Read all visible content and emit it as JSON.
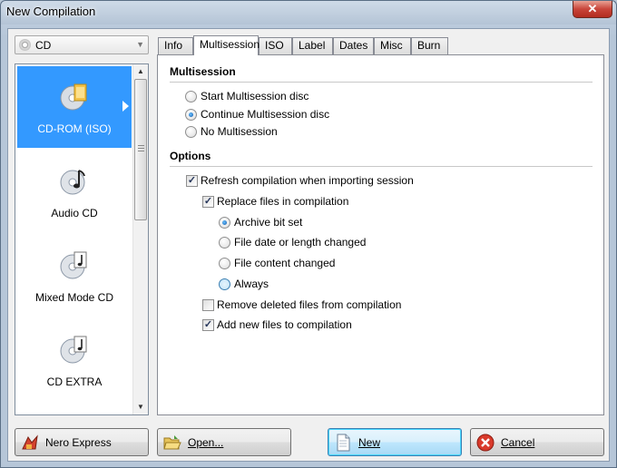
{
  "window": {
    "title": "New Compilation",
    "close_glyph": "✕"
  },
  "device": {
    "selected": "CD",
    "icon": "disc-icon"
  },
  "compilation_types": [
    {
      "label": "CD-ROM (ISO)",
      "icon": "cdrom-iso-icon",
      "selected": true
    },
    {
      "label": "Audio CD",
      "icon": "audio-cd-icon",
      "selected": false
    },
    {
      "label": "Mixed Mode CD",
      "icon": "mixed-mode-cd-icon",
      "selected": false
    },
    {
      "label": "CD EXTRA",
      "icon": "cd-extra-icon",
      "selected": false
    }
  ],
  "tabs": [
    "Info",
    "Multisession",
    "ISO",
    "Label",
    "Dates",
    "Misc",
    "Burn"
  ],
  "active_tab": "Multisession",
  "multisession": {
    "title": "Multisession",
    "options": [
      {
        "label": "Start Multisession disc",
        "checked": false
      },
      {
        "label": "Continue Multisession disc",
        "checked": true
      },
      {
        "label": "No Multisession",
        "checked": false
      }
    ]
  },
  "options": {
    "title": "Options",
    "refresh": {
      "label": "Refresh compilation when importing session",
      "checked": true
    },
    "replace": {
      "label": "Replace files in compilation",
      "checked": true
    },
    "replace_modes": [
      {
        "label": "Archive bit set",
        "checked": true
      },
      {
        "label": "File date or length changed",
        "checked": false
      },
      {
        "label": "File content changed",
        "checked": false
      },
      {
        "label": "Always",
        "checked": false
      }
    ],
    "remove_deleted": {
      "label": "Remove deleted files from compilation",
      "checked": false
    },
    "add_new": {
      "label": "Add new files to compilation",
      "checked": true
    }
  },
  "buttons": {
    "nero_express": "Nero Express",
    "open": "Open...",
    "new": "New",
    "cancel": "Cancel"
  },
  "colors": {
    "selection": "#3399ff",
    "accent": "#3c7fb1"
  }
}
